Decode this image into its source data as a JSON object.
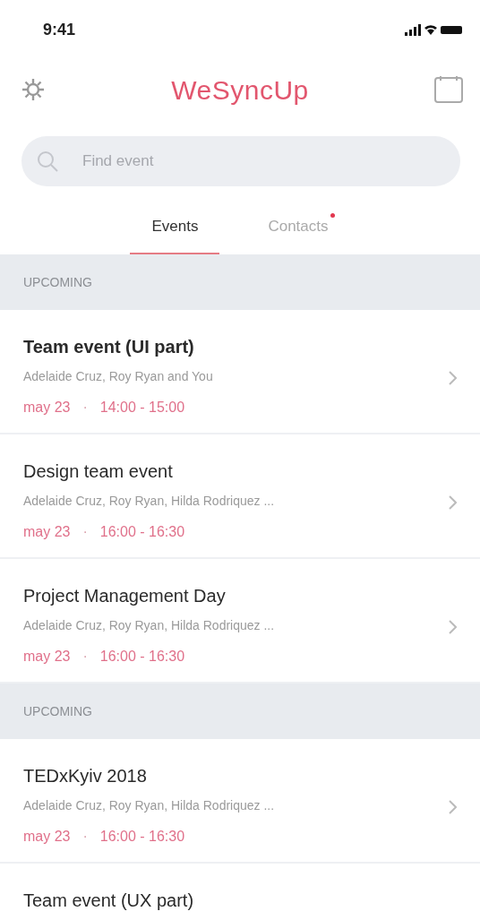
{
  "status_bar": {
    "time": "9:41"
  },
  "header": {
    "logo": "WeSyncUp"
  },
  "search": {
    "placeholder": "Find event"
  },
  "tabs": [
    {
      "label": "Events",
      "selected": true,
      "has_notification": false
    },
    {
      "label": "Contacts",
      "selected": false,
      "has_notification": true
    }
  ],
  "sections": [
    {
      "title": "UPCOMING",
      "events": [
        {
          "title": "Team event (UI part)",
          "unread": true,
          "people": "Adelaide Cruz, Roy Ryan and You",
          "date": "may 23",
          "separator": "·",
          "time": "14:00 - 15:00"
        },
        {
          "title": "Design team event",
          "unread": false,
          "people": "Adelaide Cruz, Roy Ryan, Hilda Rodriquez ...",
          "date": "may 23",
          "separator": "·",
          "time": "16:00 - 16:30"
        },
        {
          "title": "Project Management Day",
          "unread": false,
          "people": "Adelaide Cruz, Roy Ryan, Hilda Rodriquez ...",
          "date": "may 23",
          "separator": "·",
          "time": "16:00 - 16:30"
        }
      ]
    },
    {
      "title": "UPCOMING",
      "events": [
        {
          "title": "TEDxKyiv 2018",
          "unread": false,
          "people": "Adelaide Cruz, Roy Ryan, Hilda Rodriquez ...",
          "date": "may 23",
          "separator": "·",
          "time": "16:00 - 16:30"
        },
        {
          "title": "Team event (UX part)",
          "unread": false
        }
      ]
    }
  ]
}
